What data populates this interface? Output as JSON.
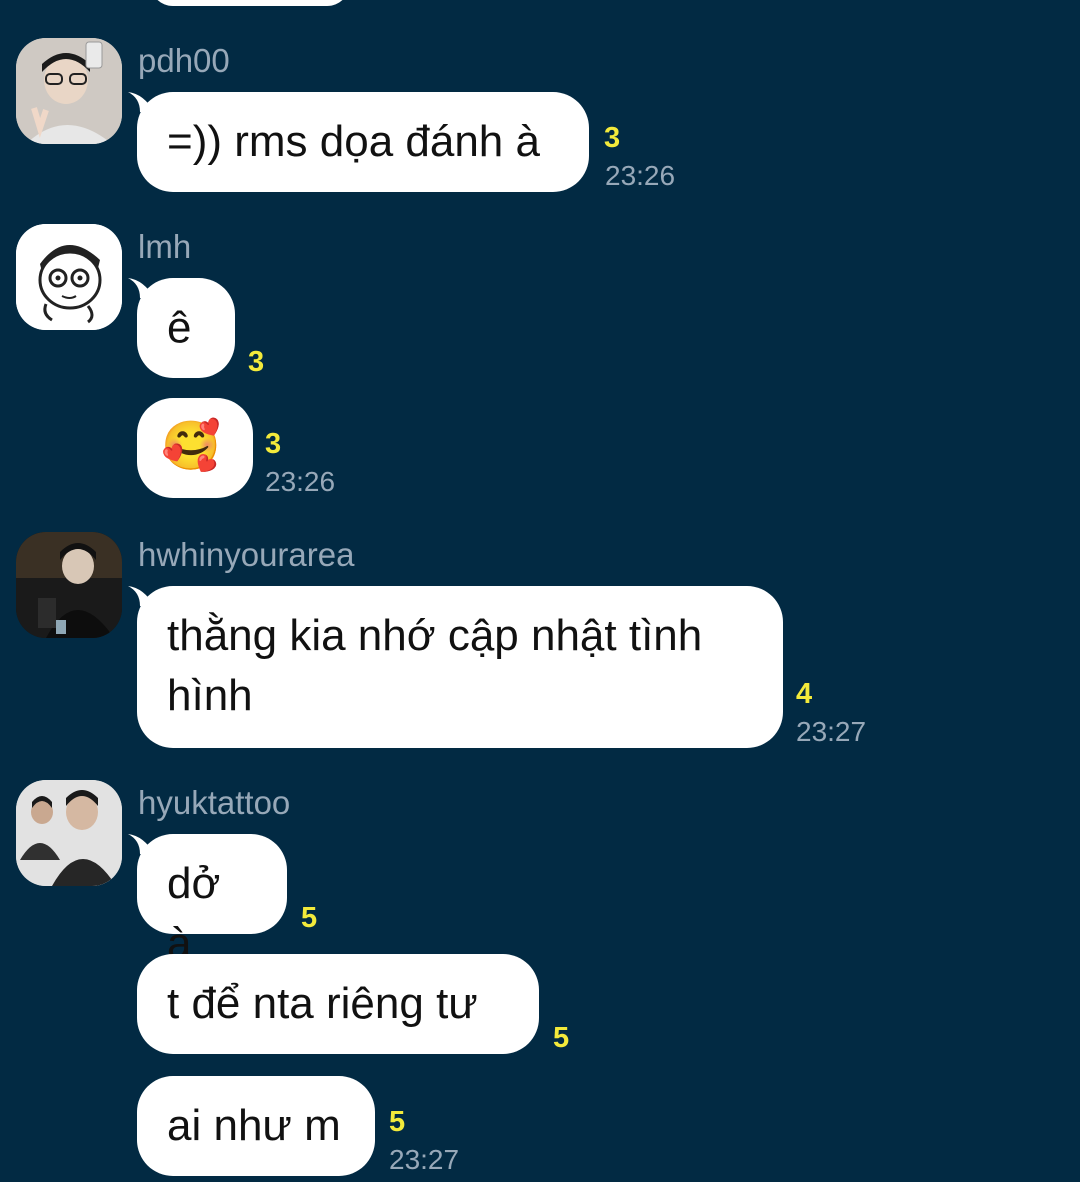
{
  "groups": [
    {
      "user": "pdh00",
      "messages": [
        {
          "text": "=)) rms dọa đánh à",
          "count": "3",
          "time": "23:26"
        }
      ]
    },
    {
      "user": "lmh",
      "messages": [
        {
          "text": "ê",
          "count": "3"
        },
        {
          "emoji": "🥰",
          "count": "3",
          "time": "23:26"
        }
      ]
    },
    {
      "user": "hwhinyourarea",
      "messages": [
        {
          "line1": "thằng kia nhớ cập nhật tình",
          "line2": "hình",
          "count": "4",
          "time": "23:27"
        }
      ]
    },
    {
      "user": "hyuktattoo",
      "messages": [
        {
          "text": "dở à",
          "count": "5"
        },
        {
          "text": "t để nta riêng tư",
          "count": "5"
        },
        {
          "text": "ai như m",
          "count": "5",
          "time": "23:27"
        }
      ]
    }
  ],
  "colors": {
    "background": "#022a43",
    "bubble": "#ffffff",
    "count": "#f3ea3b",
    "meta": "#97a8b8"
  }
}
